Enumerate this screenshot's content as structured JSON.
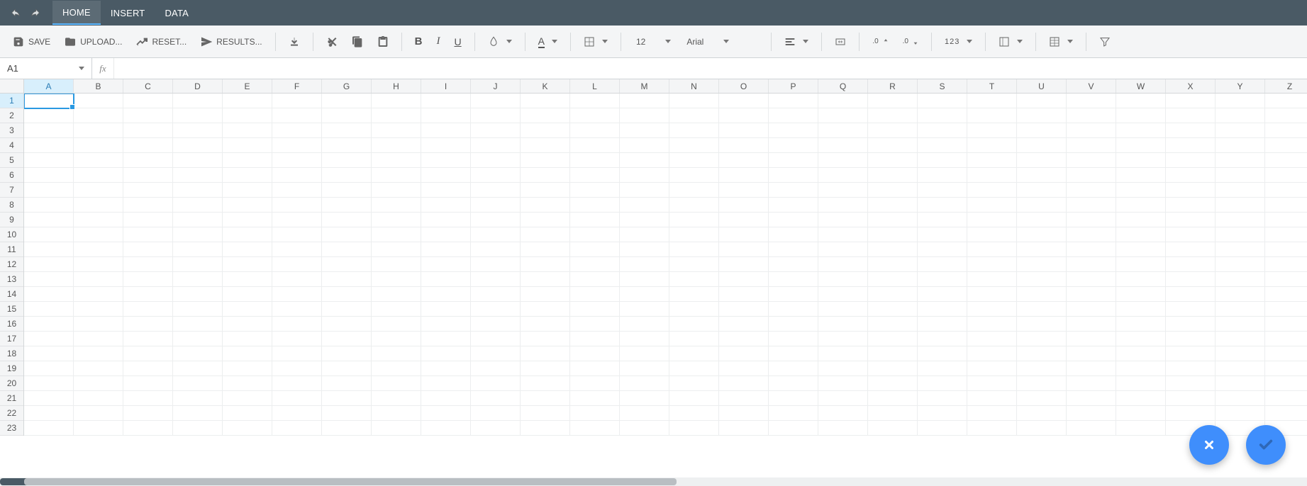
{
  "menu": {
    "tabs": [
      "HOME",
      "INSERT",
      "DATA"
    ],
    "active_index": 0
  },
  "toolbar": {
    "save": "SAVE",
    "upload": "UPLOAD...",
    "reset": "RESET...",
    "results": "RESULTS...",
    "font_size": "12",
    "font_family": "Arial",
    "number_format": "123"
  },
  "formula_bar": {
    "name_box": "A1",
    "fx_label": "fx",
    "formula": ""
  },
  "grid": {
    "columns": [
      "A",
      "B",
      "C",
      "D",
      "E",
      "F",
      "G",
      "H",
      "I",
      "J",
      "K",
      "L",
      "M",
      "N",
      "O",
      "P",
      "Q",
      "R",
      "S",
      "T",
      "U",
      "V",
      "W",
      "X",
      "Y",
      "Z"
    ],
    "rows": [
      1,
      2,
      3,
      4,
      5,
      6,
      7,
      8,
      9,
      10,
      11,
      12,
      13,
      14,
      15,
      16,
      17,
      18,
      19,
      20,
      21,
      22,
      23
    ],
    "selected_col_index": 0,
    "selected_row_index": 0
  }
}
